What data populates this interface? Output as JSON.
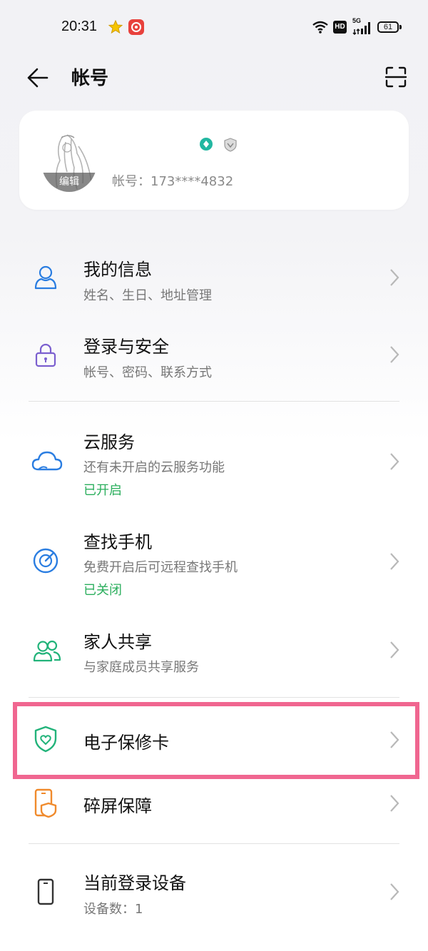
{
  "status_bar": {
    "time": "20:31",
    "hd": "HD",
    "network": "5G",
    "battery": "61"
  },
  "header": {
    "title": "帐号"
  },
  "profile": {
    "avatar_edit": "编辑",
    "account": "帐号：173****4832"
  },
  "menu": [
    {
      "title": "我的信息",
      "subtitle": "姓名、生日、地址管理"
    },
    {
      "title": "登录与安全",
      "subtitle": "帐号、密码、联系方式"
    },
    {
      "title": "云服务",
      "subtitle": "还有未开启的云服务功能",
      "status": "已开启"
    },
    {
      "title": "查找手机",
      "subtitle": "免费开启后可远程查找手机",
      "status": "已关闭"
    },
    {
      "title": "家人共享",
      "subtitle": "与家庭成员共享服务"
    },
    {
      "title": "电子保修卡"
    },
    {
      "title": "碎屏保障"
    },
    {
      "title": "当前登录设备",
      "subtitle": "设备数：1"
    }
  ],
  "colors": {
    "accent_blue": "#2a7de1",
    "status_green": "#2aae5c",
    "highlight": "#f06690",
    "lock_purple": "#7b5fcf",
    "teal": "#22b7a1",
    "orange": "#f08a2c"
  }
}
